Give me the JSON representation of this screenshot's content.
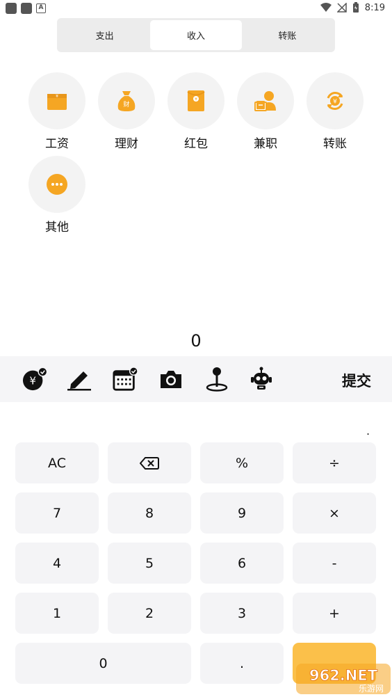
{
  "status_bar": {
    "time": "8:19"
  },
  "tabs": [
    {
      "label": "支出",
      "active": false
    },
    {
      "label": "收入",
      "active": true
    },
    {
      "label": "转账",
      "active": false
    }
  ],
  "categories": [
    {
      "label": "工资",
      "icon": "wage-box-icon"
    },
    {
      "label": "理财",
      "icon": "money-bag-icon"
    },
    {
      "label": "红包",
      "icon": "red-envelope-icon"
    },
    {
      "label": "兼职",
      "icon": "part-time-worker-icon"
    },
    {
      "label": "转账",
      "icon": "transfer-cycle-icon"
    },
    {
      "label": "其他",
      "icon": "more-dots-icon"
    }
  ],
  "amount": "0",
  "toolbar": {
    "submit_label": "提交"
  },
  "keypad": {
    "row1": [
      "AC",
      "",
      "%",
      "÷"
    ],
    "row2": [
      "7",
      "8",
      "9",
      "×"
    ],
    "row3": [
      "4",
      "5",
      "6",
      "-"
    ],
    "row4": [
      "1",
      "2",
      "3",
      "+"
    ],
    "row5": [
      "0",
      "."
    ]
  },
  "decimal_indicator": ".",
  "watermark": {
    "main": "962.NET",
    "sub": "乐游网"
  },
  "colors": {
    "accent": "#f5a623",
    "key_bg": "#f4f4f6",
    "confirm_key": "#fbc04a"
  }
}
